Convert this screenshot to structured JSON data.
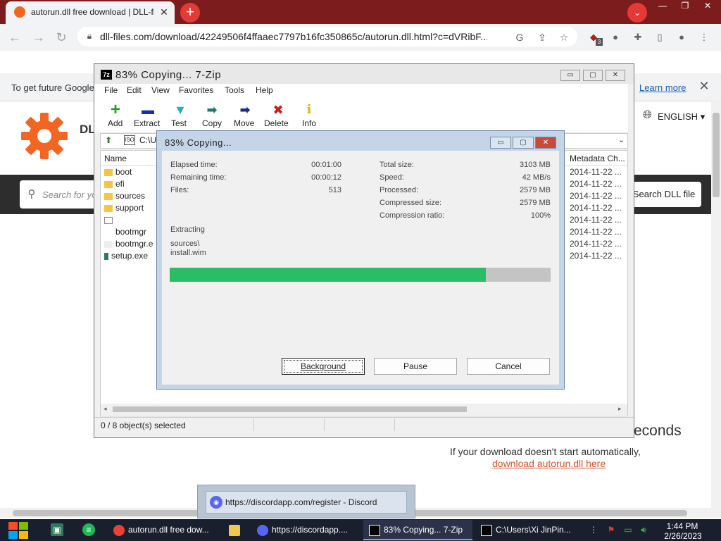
{
  "browser": {
    "tab_title": "autorun.dll free download | DLL-files.com",
    "tab_close": "✕",
    "new_tab": "+",
    "tab_search": "⌄",
    "window_buttons": [
      "—",
      "❐",
      "✕"
    ],
    "url": "dll-files.com/download/42249506f4ffaaec7797b16fc350865c/autorun.dll.html?c=dVRibF...",
    "extension_badge": "3",
    "infobar_text": "To get future Google",
    "infobar_link": "Learn more",
    "infobar_close": "✕"
  },
  "page": {
    "logo_text": "DL",
    "language": "ENGLISH",
    "search_placeholder": "Search for yo",
    "search_button": "Search DLL file",
    "seconds_text": "econds",
    "auto_text": "If your download doesn't start automatically,",
    "download_link": "download autorun.dll here"
  },
  "zip": {
    "title": "83% Copying... 7-Zip",
    "menu": [
      "File",
      "Edit",
      "View",
      "Favorites",
      "Tools",
      "Help"
    ],
    "toolbar": [
      {
        "label": "Add",
        "icon": "+",
        "color": "#1fa11f"
      },
      {
        "label": "Extract",
        "icon": "▬",
        "color": "#1a2fb0"
      },
      {
        "label": "Test",
        "icon": "▼",
        "color": "#1ab3c8"
      },
      {
        "label": "Copy",
        "icon": "➡",
        "color": "#1a7f6a"
      },
      {
        "label": "Move",
        "icon": "➡",
        "color": "#1a2a8a"
      },
      {
        "label": "Delete",
        "icon": "✖",
        "color": "#d01818"
      },
      {
        "label": "Info",
        "icon": "i",
        "color": "#d8b800"
      }
    ],
    "address": "C:\\U",
    "columns": {
      "name": "Name",
      "meta": "Metadata Ch..."
    },
    "files": [
      {
        "name": "boot",
        "type": "folder"
      },
      {
        "name": "efi",
        "type": "folder"
      },
      {
        "name": "sources",
        "type": "folder"
      },
      {
        "name": "support",
        "type": "folder"
      },
      {
        "name": "",
        "type": "file"
      },
      {
        "name": "bootmgr",
        "type": "file"
      },
      {
        "name": "bootmgr.e",
        "type": "file"
      },
      {
        "name": "setup.exe",
        "type": "exe"
      }
    ],
    "meta_values": [
      "2014-11-22 ...",
      "2014-11-22 ...",
      "2014-11-22 ...",
      "2014-11-22 ...",
      "2014-11-22 ...",
      "2014-11-22 ...",
      "2014-11-22 ...",
      "2014-11-22 ..."
    ],
    "status": "0 / 8 object(s) selected",
    "win_buttons": [
      "▭",
      "▢",
      "✕"
    ]
  },
  "copy_dialog": {
    "title": "83% Copying...",
    "left_stats": [
      {
        "label": "Elapsed time:",
        "value": "00:01:00"
      },
      {
        "label": "Remaining time:",
        "value": "00:00:12"
      },
      {
        "label": "Files:",
        "value": "513"
      }
    ],
    "right_stats": [
      {
        "label": "Total size:",
        "value": "3103 MB"
      },
      {
        "label": "Speed:",
        "value": "42 MB/s"
      },
      {
        "label": "Processed:",
        "value": "2579 MB"
      },
      {
        "label": "Compressed size:",
        "value": "2579 MB"
      },
      {
        "label": "Compression ratio:",
        "value": "100%"
      }
    ],
    "operation": "Extracting",
    "current_path": "sources\\",
    "current_file": "install.wim",
    "progress": 0.83,
    "buttons": {
      "background": "Background",
      "pause": "Pause",
      "cancel": "Cancel"
    },
    "win_buttons": [
      "▭",
      "▢",
      "✕"
    ],
    "progress_color": "#2bbd63"
  },
  "discord_preview": {
    "text": "https://discordapp.com/register - Discord"
  },
  "taskbar": {
    "items": [
      {
        "label": "autorun.dll free dow...",
        "icon_color": "#e94235"
      },
      {
        "label": "",
        "icon_color": "#f2c94c"
      },
      {
        "label": "https://discordapp....",
        "icon_color": "#5865f2"
      },
      {
        "label": "83% Copying... 7-Zip",
        "icon_color": "#000000"
      },
      {
        "label": "C:\\Users\\Xi JinPin...",
        "icon_color": "#000000"
      }
    ],
    "time": "1:44 PM",
    "date": "2/26/2023"
  }
}
